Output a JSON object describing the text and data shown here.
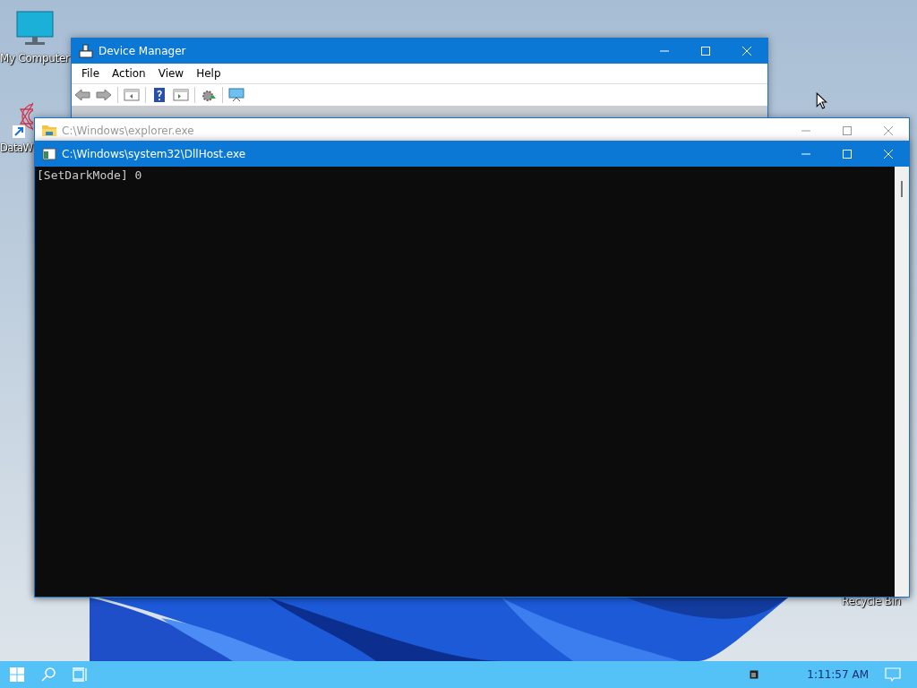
{
  "desktop_icons": [
    {
      "label": "My Computer",
      "kind": "computer"
    },
    {
      "label": "DataW",
      "kind": "shortcut"
    },
    {
      "label": "Recycle Bin",
      "kind": "bin"
    }
  ],
  "windows": [
    {
      "title": "Device Manager",
      "active": true,
      "kind": "mmc",
      "menu": [
        "File",
        "Action",
        "View",
        "Help"
      ]
    },
    {
      "title": "C:\\Windows\\explorer.exe",
      "active": false,
      "kind": "explorer"
    },
    {
      "title": "C:\\Windows\\system32\\DllHost.exe",
      "active": true,
      "kind": "console",
      "output": "[SetDarkMode] 0"
    }
  ],
  "taskbar": {
    "clock": "1:11:57 AM"
  }
}
